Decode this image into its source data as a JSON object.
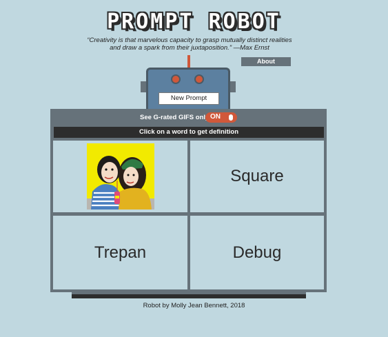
{
  "header": {
    "logo": "PROMPT ROBOT",
    "quote": "“Creativity is that marvelous capacity to grasp mutually distinct realities and draw a spark from their juxtaposition.” —Max Ernst",
    "about_label": "About"
  },
  "robot": {
    "new_prompt_label": "New Prompt",
    "grated_label": "See G-rated GIFS only",
    "toggle_label": "ON",
    "definition_hint": "Click on a word to get definition"
  },
  "grid": {
    "words": [
      "Square",
      "Trepan",
      "Debug"
    ]
  },
  "footer": {
    "credit": "Robot by Molly Jean Bennett, 2018"
  },
  "colors": {
    "background": "#c0d8e0",
    "panel": "#66727a",
    "accent": "#d0583a",
    "robot_head": "#5c80a0",
    "dark_bar": "#2d2d2d"
  }
}
